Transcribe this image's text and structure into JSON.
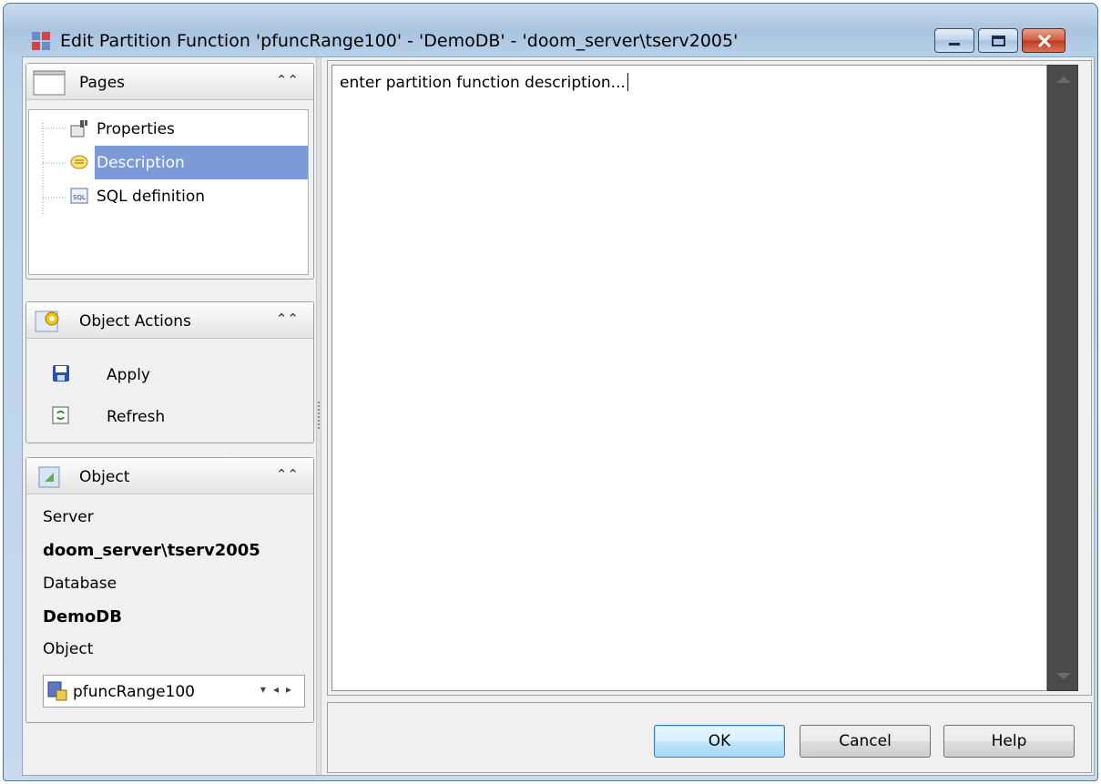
{
  "window": {
    "title": "Edit Partition Function 'pfuncRange100' - 'DemoDB' - 'doom_server\\tserv2005'"
  },
  "pages_panel": {
    "title": "Pages",
    "items": [
      {
        "label": "Properties",
        "icon": "properties-icon",
        "selected": false
      },
      {
        "label": "Description",
        "icon": "description-icon",
        "selected": true
      },
      {
        "label": "SQL definition",
        "icon": "sql-icon",
        "selected": false
      }
    ]
  },
  "actions_panel": {
    "title": "Object Actions",
    "items": [
      {
        "label": "Apply",
        "icon": "save-icon"
      },
      {
        "label": "Refresh",
        "icon": "refresh-icon"
      }
    ]
  },
  "object_panel": {
    "title": "Object",
    "server_label": "Server",
    "server_value": "doom_server\\tserv2005",
    "database_label": "Database",
    "database_value": "DemoDB",
    "object_label": "Object",
    "object_value": "pfuncRange100"
  },
  "editor": {
    "text": "enter partition function description..."
  },
  "buttons": {
    "ok": "OK",
    "cancel": "Cancel",
    "help": "Help"
  },
  "colors": {
    "selection": "#7c9ad6",
    "titlebar": "#a9c4e0",
    "close_button": "#c0391c"
  }
}
